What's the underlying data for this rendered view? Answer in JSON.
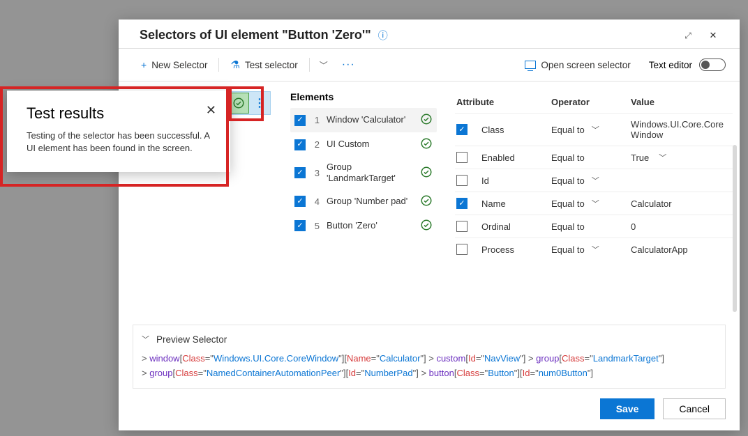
{
  "title": "Selectors of UI element \"Button 'Zero'\"",
  "toolbar": {
    "new_selector": "New Selector",
    "test_selector": "Test selector",
    "open_screen_selector": "Open screen selector",
    "text_editor": "Text editor"
  },
  "selector_list": {
    "selected_index": 0
  },
  "elements_header": "Elements",
  "elements": [
    {
      "n": 1,
      "label": "Window 'Calculator'",
      "checked": true,
      "ok": true,
      "selected": true
    },
    {
      "n": 2,
      "label": "UI Custom",
      "checked": true,
      "ok": true
    },
    {
      "n": 3,
      "label": "Group 'LandmarkTarget'",
      "checked": true,
      "ok": true
    },
    {
      "n": 4,
      "label": "Group 'Number pad'",
      "checked": true,
      "ok": true
    },
    {
      "n": 5,
      "label": "Button 'Zero'",
      "checked": true,
      "ok": true
    }
  ],
  "attr_headers": {
    "attribute": "Attribute",
    "operator": "Operator",
    "value": "Value"
  },
  "attributes": [
    {
      "name": "Class",
      "op": "Equal to",
      "val": "Windows.UI.Core.CoreWindow",
      "checked": true,
      "op_chev": true,
      "val_chev": false
    },
    {
      "name": "Enabled",
      "op": "Equal to",
      "val": "True",
      "checked": false,
      "op_chev": false,
      "val_chev": true
    },
    {
      "name": "Id",
      "op": "Equal to",
      "val": "",
      "checked": false,
      "op_chev": true,
      "val_chev": false
    },
    {
      "name": "Name",
      "op": "Equal to",
      "val": "Calculator",
      "checked": true,
      "op_chev": true,
      "val_chev": false
    },
    {
      "name": "Ordinal",
      "op": "Equal to",
      "val": "0",
      "checked": false,
      "op_chev": false,
      "val_chev": false
    },
    {
      "name": "Process",
      "op": "Equal to",
      "val": "CalculatorApp",
      "checked": false,
      "op_chev": true,
      "val_chev": false
    }
  ],
  "preview": {
    "label": "Preview Selector",
    "tokens": [
      {
        "t": "op",
        "v": "> "
      },
      {
        "t": "kw",
        "v": "window"
      },
      {
        "t": "op",
        "v": "["
      },
      {
        "t": "attr",
        "v": "Class"
      },
      {
        "t": "op",
        "v": "=\""
      },
      {
        "t": "str",
        "v": "Windows.UI.Core.CoreWindow"
      },
      {
        "t": "op",
        "v": "\"]"
      },
      {
        "t": "op",
        "v": "["
      },
      {
        "t": "attr",
        "v": "Name"
      },
      {
        "t": "op",
        "v": "=\""
      },
      {
        "t": "str",
        "v": "Calculator"
      },
      {
        "t": "op",
        "v": "\"] > "
      },
      {
        "t": "kw",
        "v": "custom"
      },
      {
        "t": "op",
        "v": "["
      },
      {
        "t": "attr",
        "v": "Id"
      },
      {
        "t": "op",
        "v": "=\""
      },
      {
        "t": "str",
        "v": "NavView"
      },
      {
        "t": "op",
        "v": "\"] > "
      },
      {
        "t": "kw",
        "v": "group"
      },
      {
        "t": "op",
        "v": "["
      },
      {
        "t": "attr",
        "v": "Class"
      },
      {
        "t": "op",
        "v": "=\""
      },
      {
        "t": "str",
        "v": "LandmarkTarget"
      },
      {
        "t": "op",
        "v": "\"]"
      },
      {
        "t": "brk",
        "v": ""
      },
      {
        "t": "op",
        "v": "> "
      },
      {
        "t": "kw",
        "v": "group"
      },
      {
        "t": "op",
        "v": "["
      },
      {
        "t": "attr",
        "v": "Class"
      },
      {
        "t": "op",
        "v": "=\""
      },
      {
        "t": "str",
        "v": "NamedContainerAutomationPeer"
      },
      {
        "t": "op",
        "v": "\"]"
      },
      {
        "t": "op",
        "v": "["
      },
      {
        "t": "attr",
        "v": "Id"
      },
      {
        "t": "op",
        "v": "=\""
      },
      {
        "t": "str",
        "v": "NumberPad"
      },
      {
        "t": "op",
        "v": "\"] > "
      },
      {
        "t": "kw",
        "v": "button"
      },
      {
        "t": "op",
        "v": "["
      },
      {
        "t": "attr",
        "v": "Class"
      },
      {
        "t": "op",
        "v": "=\""
      },
      {
        "t": "str",
        "v": "Button"
      },
      {
        "t": "op",
        "v": "\"]"
      },
      {
        "t": "op",
        "v": "["
      },
      {
        "t": "attr",
        "v": "Id"
      },
      {
        "t": "op",
        "v": "=\""
      },
      {
        "t": "str",
        "v": "num0Button"
      },
      {
        "t": "op",
        "v": "\"]"
      }
    ]
  },
  "footer": {
    "save": "Save",
    "cancel": "Cancel"
  },
  "popup": {
    "title": "Test results",
    "body": "Testing of the selector has been successful. A UI element has been found in the screen."
  }
}
